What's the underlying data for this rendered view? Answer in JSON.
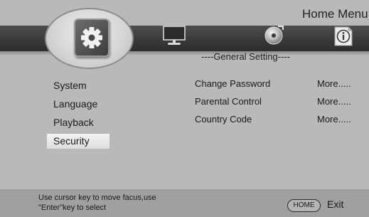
{
  "header": {
    "menu_title": "Home Menu"
  },
  "top_icons": [
    {
      "name": "setup",
      "icon": "gear-icon",
      "selected": true
    },
    {
      "name": "tv",
      "icon": "tv-icon",
      "selected": false
    },
    {
      "name": "disc",
      "icon": "disc-icon",
      "selected": false
    },
    {
      "name": "info",
      "icon": "info-icon",
      "selected": false
    }
  ],
  "section": {
    "title": "----General Setting----"
  },
  "left_menu": {
    "items": [
      {
        "label": "System"
      },
      {
        "label": "Language"
      },
      {
        "label": "Playback"
      },
      {
        "label": "Security"
      }
    ],
    "selected_index": 3
  },
  "settings": [
    {
      "label": "Change Password",
      "action": "More....."
    },
    {
      "label": "Parental Control",
      "action": "More....."
    },
    {
      "label": "Country Code",
      "action": "More....."
    }
  ],
  "footer": {
    "hint": "Use cursor key to move facus,use \"Enter\"key to select",
    "home_key": "HOME",
    "exit_label": "Exit"
  },
  "colors": {
    "background": "#b9b9b9",
    "icon_bar": "#3a3a3a",
    "footer": "#a0a0a0",
    "selected_item": "#e8e8e8"
  }
}
